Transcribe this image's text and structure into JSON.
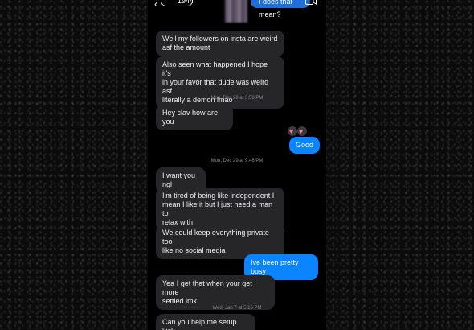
{
  "header": {
    "back_label": "1944",
    "top_partial_message": "I does that mean?"
  },
  "messages": {
    "m1": "Well my followers on insta are weird\nasf the amount",
    "m2": "Also seen what happened I hope it's\nin your favor that dude was weird asf\nliterally a demon lmao",
    "m3": "Hey clav how are you",
    "m4": "Good",
    "m5": "I want you ngl",
    "m6": "I'm tired of being like independent I\nmean I like it but I just need a man to\nrelax with",
    "m7": "We could keep everything private too\nlike no social media",
    "m8": "Ive been pretty busy",
    "m9": "Yea I get that when your get more\nsettled lmk",
    "m10": "Can you help me setup kick"
  },
  "timestamps": {
    "t1": "Mon, Dec 29 at 3:58 PM",
    "t2": "Mon, Dec 29 at 9:48 PM",
    "t3": "Wed, Jan 7 at 5:16 PM"
  },
  "reactions": {
    "hearts": "♥♥"
  },
  "colors": {
    "incoming_bubble": "#262628",
    "outgoing_bubble": "#0a84ff"
  }
}
